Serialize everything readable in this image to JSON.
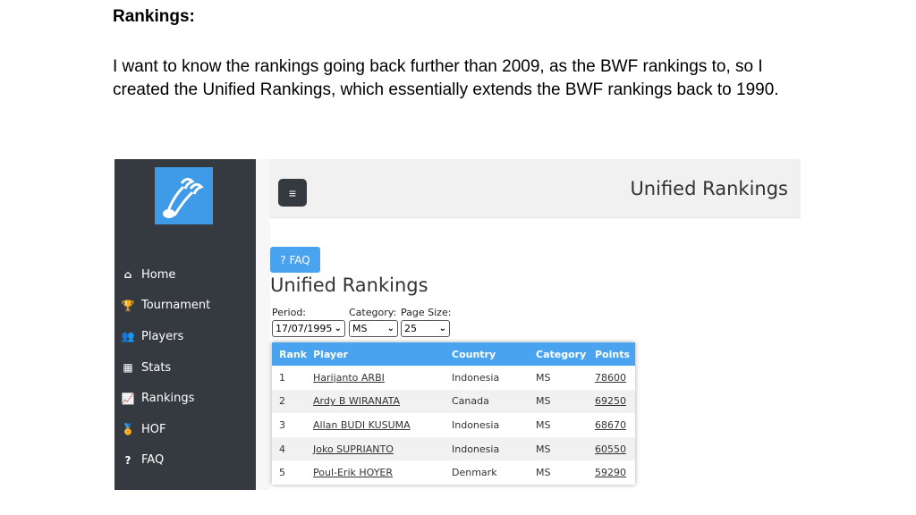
{
  "doc": {
    "heading": "Rankings:",
    "paragraph": "I want to know the rankings going back further than 2009, as the BWF rankings to, so I created the Unified Rankings, which essentially extends the BWF rankings back to 1990."
  },
  "app": {
    "brand_title": "Unified Rankings",
    "hamburger_icon": "≡",
    "logo_icon": "shuttlecock-logo",
    "colors": {
      "sidebar": "#343a40",
      "accent": "#4aa3ef"
    }
  },
  "sidebar": {
    "items": [
      {
        "label": "Home",
        "icon": "home-icon",
        "glyph": "⌂"
      },
      {
        "label": "Tournament",
        "icon": "trophy-icon",
        "glyph": "🏆"
      },
      {
        "label": "Players",
        "icon": "users-icon",
        "glyph": "👥"
      },
      {
        "label": "Stats",
        "icon": "table-icon",
        "glyph": "▦"
      },
      {
        "label": "Rankings",
        "icon": "chart-line-icon",
        "glyph": "📈"
      },
      {
        "label": "HOF",
        "icon": "medal-icon",
        "glyph": "🏅"
      },
      {
        "label": "FAQ",
        "icon": "question-icon",
        "glyph": "?"
      }
    ]
  },
  "main": {
    "faq_button": "? FAQ",
    "title": "Unified Rankings",
    "filters": {
      "period_label": "Period:",
      "period_value": "17/07/1995",
      "category_label": "Category:",
      "category_value": "MS",
      "pagesize_label": "Page Size:",
      "pagesize_value": "25"
    },
    "table": {
      "headers": [
        "Rank",
        "Player",
        "Country",
        "Category",
        "Points"
      ],
      "rows": [
        [
          "1",
          "Harijanto ARBI",
          "Indonesia",
          "MS",
          "78600"
        ],
        [
          "2",
          "Ardy B WIRANATA",
          "Canada",
          "MS",
          "69250"
        ],
        [
          "3",
          "Allan BUDI KUSUMA",
          "Indonesia",
          "MS",
          "68670"
        ],
        [
          "4",
          "Joko SUPRIANTO",
          "Indonesia",
          "MS",
          "60550"
        ],
        [
          "5",
          "Poul-Erik HOYER",
          "Denmark",
          "MS",
          "59290"
        ]
      ]
    }
  }
}
